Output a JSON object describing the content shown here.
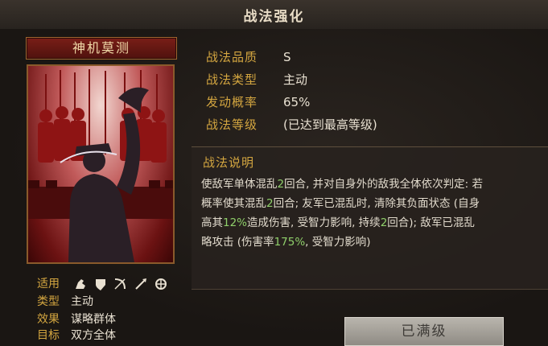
{
  "title": "战法强化",
  "skill_name": "神机莫测",
  "properties": [
    {
      "label": "战法品质",
      "value": "S"
    },
    {
      "label": "战法类型",
      "value": "主动"
    },
    {
      "label": "发动概率",
      "value": "65%"
    },
    {
      "label": "战法等级",
      "value": "(已达到最高等级)"
    }
  ],
  "description": {
    "heading": "战法说明",
    "lines": [
      [
        {
          "t": "使敌军单体混乱"
        },
        {
          "t": "2",
          "hl": true
        },
        {
          "t": "回合, 并对自身外的敌我全体依次判定: 若"
        }
      ],
      [
        {
          "t": "概率使其混乱"
        },
        {
          "t": "2",
          "hl": true
        },
        {
          "t": "回合; 友军已混乱时, 清除其负面状态 (自身"
        }
      ],
      [
        {
          "t": "高其"
        },
        {
          "t": "12%",
          "hl": true
        },
        {
          "t": "造成伤害, 受智力影响, 持续"
        },
        {
          "t": "2",
          "hl": true
        },
        {
          "t": "回合); 敌军已混乱"
        }
      ],
      [
        {
          "t": "略攻击 (伤害率"
        },
        {
          "t": "175%",
          "hl": true
        },
        {
          "t": ", 受智力影响)"
        }
      ]
    ]
  },
  "meta": {
    "applies_label": "适用",
    "applies_icons": [
      "cavalry-icon",
      "shield-icon",
      "bow-icon",
      "spear-icon",
      "siege-icon"
    ],
    "type_label": "类型",
    "type_value": "主动",
    "effect_label": "效果",
    "effect_value": "谋略群体",
    "target_label": "目标",
    "target_value": "双方全体"
  },
  "button_label": "已满级",
  "colors": {
    "gold": "#d4a640",
    "highlight": "#8fcf6a",
    "card_red": "#c15a5a"
  }
}
